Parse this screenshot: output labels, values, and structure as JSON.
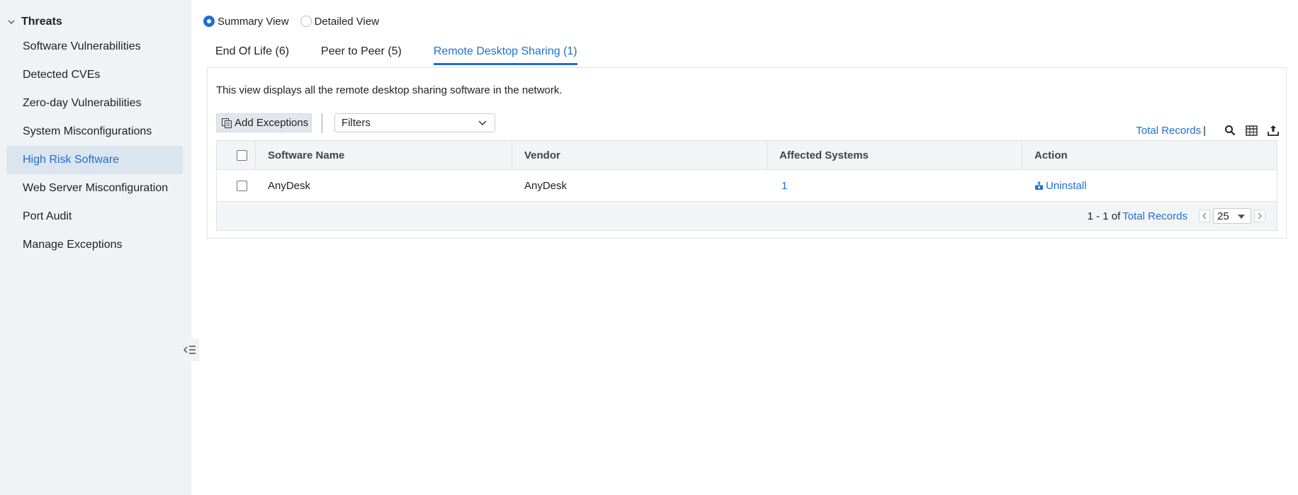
{
  "sidebar": {
    "section": "Threats",
    "items": [
      {
        "label": "Software Vulnerabilities"
      },
      {
        "label": "Detected CVEs"
      },
      {
        "label": "Zero-day Vulnerabilities"
      },
      {
        "label": "System Misconfigurations"
      },
      {
        "label": "High Risk Software",
        "active": true
      },
      {
        "label": "Web Server Misconfiguration"
      },
      {
        "label": "Port Audit"
      },
      {
        "label": "Manage Exceptions"
      }
    ],
    "collapse_icon": "collapse-sidebar-icon"
  },
  "view_toggle": {
    "summary": "Summary View",
    "detailed": "Detailed View",
    "selected": "Summary View"
  },
  "tabs": [
    {
      "label": "End Of Life (6)"
    },
    {
      "label": "Peer to Peer (5)"
    },
    {
      "label": "Remote Desktop Sharing (1)",
      "active": true
    }
  ],
  "panel": {
    "description": "This view displays all the remote desktop sharing software in the network.",
    "add_exceptions": "Add Exceptions",
    "filters": "Filters",
    "total_records": "Total Records",
    "separator": "|"
  },
  "table": {
    "columns": [
      "Software Name",
      "Vendor",
      "Affected Systems",
      "Action"
    ],
    "rows": [
      {
        "software": "AnyDesk",
        "vendor": "AnyDesk",
        "affected": "1",
        "action": "Uninstall"
      }
    ]
  },
  "footer": {
    "range": "1 - 1 of",
    "total_records": "Total Records",
    "page_size": "25"
  },
  "colors": {
    "accent": "#1e6fd0",
    "sidebar_bg": "#f1f2f5",
    "active_item_bg": "#dbe5f0"
  }
}
